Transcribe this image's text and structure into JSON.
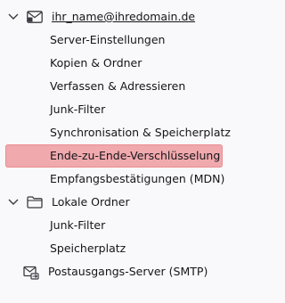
{
  "account": {
    "name": "ihr_name@ihredomain.de",
    "items": [
      "Server-Einstellungen",
      "Kopien & Ordner",
      "Verfassen & Adressieren",
      "Junk-Filter",
      "Synchronisation & Speicherplatz",
      "Ende-zu-Ende-Verschlüsselung",
      "Empfangsbestätigungen (MDN)"
    ],
    "selected_item": "Ende-zu-Ende-Verschlüsselung",
    "selected_color": "#f0a9ad"
  },
  "local_folders": {
    "name": "Lokale Ordner",
    "items": [
      "Junk-Filter",
      "Speicherplatz"
    ]
  },
  "smtp": {
    "label": "Postausgangs-Server (SMTP)"
  },
  "icons": {
    "account": "mail-account-icon",
    "local": "folder-icon",
    "smtp": "outgoing-server-icon",
    "twisty": "chevron-down-icon"
  }
}
